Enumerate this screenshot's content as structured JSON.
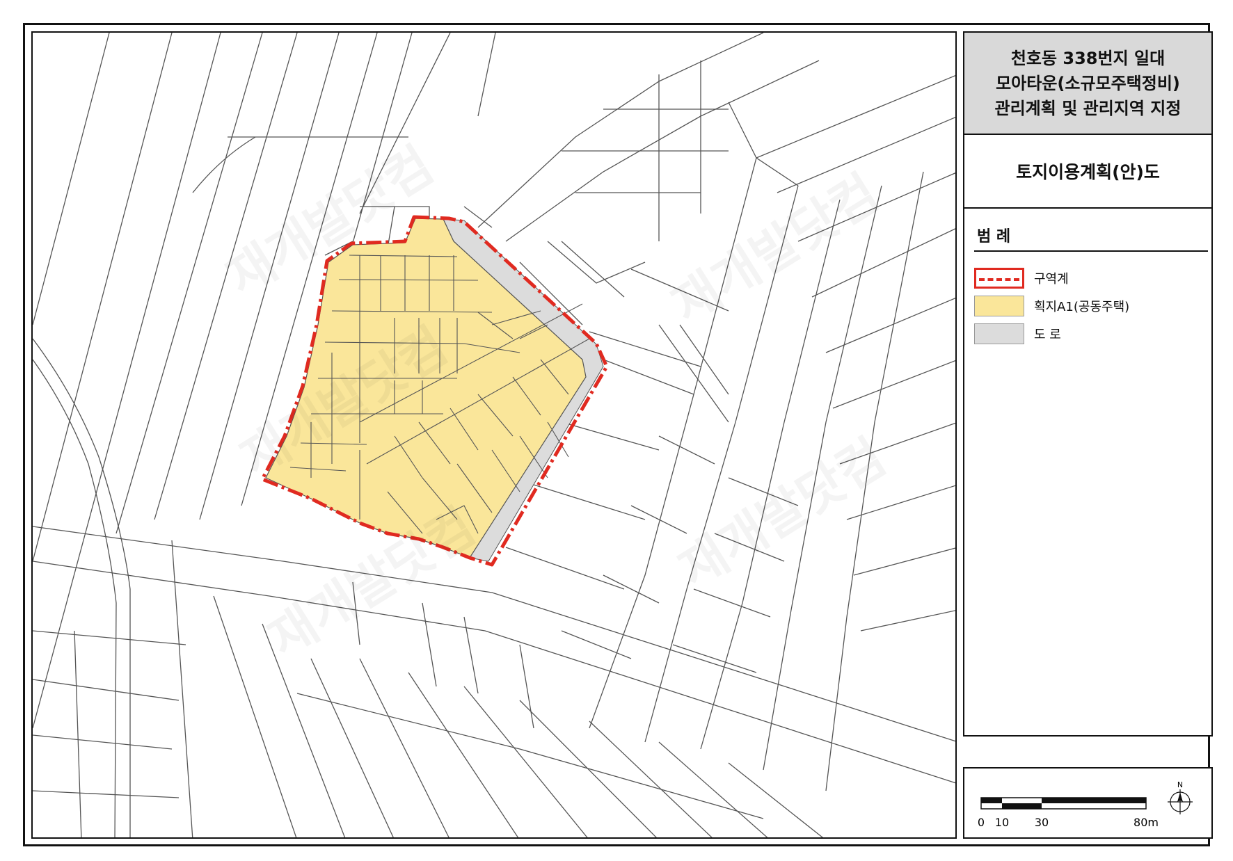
{
  "title": {
    "line1": "천호동 338번지 일대",
    "line2": "모아타운(소규모주택정비)",
    "line3": "관리계획 및 관리지역 지정"
  },
  "subtitle": "토지이용계획(안)도",
  "legend": {
    "heading": "범 례",
    "items": [
      {
        "label": "구역계",
        "color": "#e02a20"
      },
      {
        "label": "획지A1(공동주택)",
        "color": "#fae69a"
      },
      {
        "label": "도 로",
        "color": "#dcdcdc"
      }
    ]
  },
  "scale": {
    "ticks": [
      "0",
      "10",
      "30",
      "80m"
    ],
    "north": "N"
  },
  "watermark": "재개발닷컴",
  "colors": {
    "boundary": "#e02a20",
    "site": "#fae69a",
    "road": "#dcdcdc",
    "parcel_line": "#555555"
  }
}
